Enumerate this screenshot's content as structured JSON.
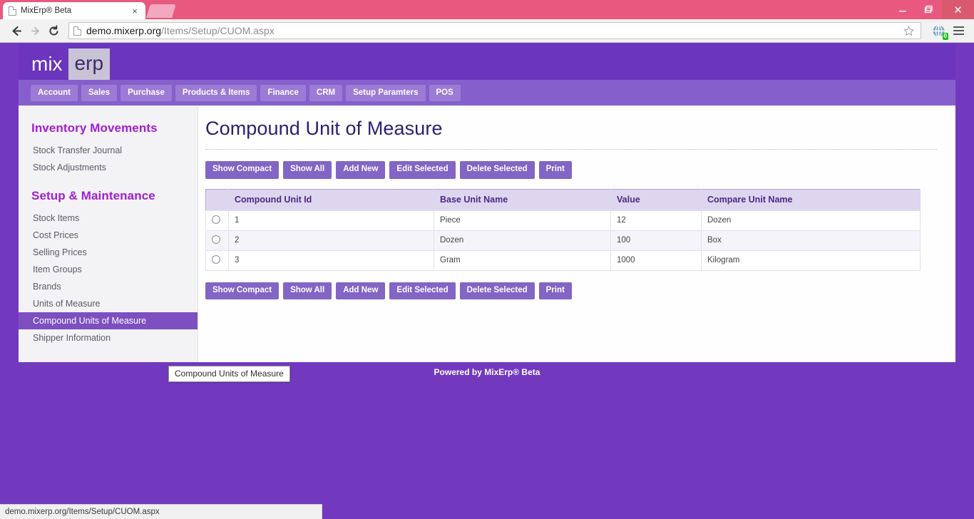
{
  "browser": {
    "tab_title": "MixErp® Beta",
    "tab_close_label": "×",
    "url_host": "demo.mixerp.org",
    "url_path": "/Items/Setup/CUOM.aspx",
    "extension_badge": "0",
    "window_close_label": "✕",
    "status_url": "demo.mixerp.org/Items/Setup/CUOM.aspx"
  },
  "header": {
    "logo_first": "mix",
    "logo_second": "erp"
  },
  "nav": {
    "items": [
      {
        "label": "Account"
      },
      {
        "label": "Sales"
      },
      {
        "label": "Purchase"
      },
      {
        "label": "Products & Items"
      },
      {
        "label": "Finance"
      },
      {
        "label": "CRM"
      },
      {
        "label": "Setup Paramters"
      },
      {
        "label": "POS"
      }
    ]
  },
  "sidebar": {
    "group1_title": "Inventory Movements",
    "group1_items": [
      {
        "label": "Stock Transfer Journal"
      },
      {
        "label": "Stock Adjustments"
      }
    ],
    "group2_title": "Setup & Maintenance",
    "group2_items": [
      {
        "label": "Stock Items",
        "active": false
      },
      {
        "label": "Cost Prices",
        "active": false
      },
      {
        "label": "Selling Prices",
        "active": false
      },
      {
        "label": "Item Groups",
        "active": false
      },
      {
        "label": "Brands",
        "active": false
      },
      {
        "label": "Units of Measure",
        "active": false
      },
      {
        "label": "Compound Units of Measure",
        "active": true
      },
      {
        "label": "Shipper Information",
        "active": false
      }
    ]
  },
  "main": {
    "page_title": "Compound Unit of Measure",
    "toolbar": [
      {
        "label": "Show Compact"
      },
      {
        "label": "Show All"
      },
      {
        "label": "Add New"
      },
      {
        "label": "Edit Selected"
      },
      {
        "label": "Delete Selected"
      },
      {
        "label": "Print"
      }
    ],
    "table": {
      "columns": [
        "",
        "Compound Unit Id",
        "Base Unit Name",
        "Value",
        "Compare Unit Name"
      ],
      "rows": [
        {
          "id": "1",
          "base_unit": "Piece",
          "value": "12",
          "compare_unit": "Dozen"
        },
        {
          "id": "2",
          "base_unit": "Dozen",
          "value": "100",
          "compare_unit": "Box"
        },
        {
          "id": "3",
          "base_unit": "Gram",
          "value": "1000",
          "compare_unit": "Kilogram"
        }
      ]
    }
  },
  "tooltip": {
    "text": "Compound Units of Measure"
  },
  "footer": {
    "text": "Powered by MixErp® Beta"
  },
  "colors": {
    "page_background": "#7239bf",
    "header_band": "#6b35bd",
    "nav_band": "#8560cc",
    "nav_item": "#9b7bd6",
    "button": "#8265c4",
    "sidebar_active": "#7d4fc0",
    "sidebar_heading": "#a01fcf",
    "title": "#2b2170",
    "table_header": "#ded6ef",
    "browser_tabstrip": "#e8587f",
    "badge_green": "#19c419"
  }
}
